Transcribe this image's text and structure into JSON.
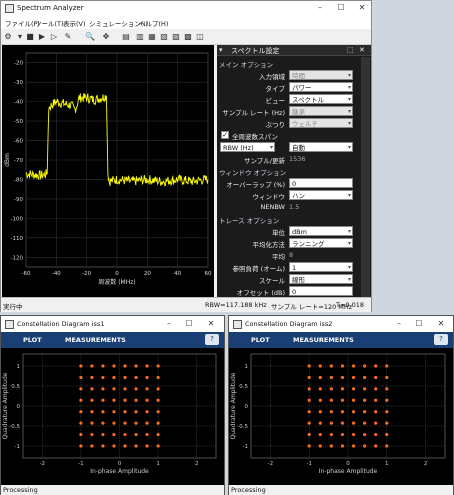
{
  "spectrum_window": {
    "title": "Spectrum Analyzer",
    "menu": [
      "ファイル(F)",
      "ツール(T)",
      "表示(V)",
      "シミュレーション(I)",
      "ヘルプ(H)"
    ],
    "y_axis": {
      "label": "dBm",
      "ticks": [
        "-20",
        "-30",
        "-40",
        "-50",
        "-60",
        "-70",
        "-80",
        "-90",
        "-100",
        "-110",
        "-120"
      ]
    },
    "x_axis": {
      "label": "周波数 (MHz)",
      "ticks": [
        "-60",
        "-40",
        "-20",
        "0",
        "20",
        "40",
        "60"
      ]
    },
    "trace_color": "#ffff00",
    "status": {
      "left": "実行中",
      "rbw": "RBW=117.188 kHz",
      "sample_rate": "サンプル レート=120 MHz",
      "time": "T=0.018"
    }
  },
  "panel": {
    "title": "スペクトル設定",
    "main_section": "メイン オプション",
    "main_rows": [
      {
        "label": "入力領域",
        "value": "時間",
        "disabled": true
      },
      {
        "label": "タイプ",
        "value": "パワー",
        "disabled": false
      },
      {
        "label": "ビュー",
        "value": "スペクトル",
        "disabled": false
      },
      {
        "label": "サンプル レート (Hz)",
        "value": "継承",
        "disabled": true
      },
      {
        "label": "ぶつり",
        "value": "ウェルチ",
        "disabled": true
      }
    ],
    "full_span_checkbox": "全周波数スパン",
    "rbw_field": "RBW (Hz)",
    "rbw_value": "自動",
    "samples_per_update_label": "サンプル/更新",
    "samples_per_update_value": "1536",
    "window_section": "ウィンドウ オプション",
    "window_rows": [
      {
        "label": "オーバーラップ (%)",
        "value": "0"
      },
      {
        "label": "ウィンドウ",
        "value": "ハン"
      },
      {
        "label": "NENBW",
        "value": "1.5"
      }
    ],
    "trace_section": "トレース オプション",
    "trace_rows": [
      {
        "label": "単位",
        "value": "dBm"
      },
      {
        "label": "平均化方法",
        "value": "ランニング"
      },
      {
        "label": "平均",
        "value": "8"
      },
      {
        "label": "参照負荷 (オーム)",
        "value": "1"
      },
      {
        "label": "スケール",
        "value": "線形"
      },
      {
        "label": "オフセット (dB)",
        "value": "0"
      }
    ]
  },
  "constellation_1": {
    "title": "Constellation Diagram iss1",
    "tab_plot": "PLOT",
    "tab_measurements": "MEASUREMENTS",
    "xlabel": "In-phase Amplitude",
    "ylabel": "Quadrature Amplitude",
    "x_ticks": [
      "-2",
      "-1",
      "0",
      "1",
      "2"
    ],
    "y_ticks": [
      "1",
      "0.5",
      "0",
      "-0.5",
      "-1"
    ],
    "status": "Processing"
  },
  "constellation_2": {
    "title": "Constellation Diagram iss2",
    "tab_plot": "PLOT",
    "tab_measurements": "MEASUREMENTS",
    "xlabel": "In-phase Amplitude",
    "ylabel": "Quadrature Amplitude",
    "x_ticks": [
      "-2",
      "-1",
      "0",
      "1",
      "2"
    ],
    "y_ticks": [
      "1",
      "0.5",
      "0",
      "-0.5",
      "-1"
    ],
    "status": "Processing"
  },
  "chart_data": [
    {
      "type": "line",
      "title": "",
      "xlabel": "周波数 (MHz)",
      "ylabel": "dBm",
      "xlim": [
        -60,
        60
      ],
      "ylim": [
        -125,
        -15
      ],
      "grid": true,
      "series": [
        {
          "x": [
            -60,
            -50,
            -46,
            -45,
            -40,
            -35,
            -30,
            -28,
            -27,
            -25,
            -20,
            -15,
            -10,
            -7,
            -6,
            -5,
            0,
            10,
            20,
            30,
            40,
            50,
            58,
            60
          ],
          "values": [
            -77,
            -78,
            -77,
            -43,
            -40,
            -41,
            -42,
            -44,
            -43,
            -38,
            -38,
            -39,
            -38,
            -37,
            -77,
            -81,
            -80,
            -81,
            -80,
            -81,
            -80,
            -81,
            -80,
            -80
          ]
        }
      ]
    },
    {
      "type": "scatter",
      "title": "",
      "xlabel": "In-phase Amplitude",
      "ylabel": "Quadrature Amplitude",
      "xlim": [
        -2.5,
        2.5
      ],
      "ylim": [
        -1.3,
        1.3
      ],
      "grid": true,
      "points_i": [
        -1,
        -0.714,
        -0.429,
        -0.143,
        0.143,
        0.429,
        0.714,
        1
      ],
      "points_q": [
        -1,
        -0.714,
        -0.429,
        -0.143,
        0.143,
        0.429,
        0.714,
        1
      ]
    }
  ]
}
